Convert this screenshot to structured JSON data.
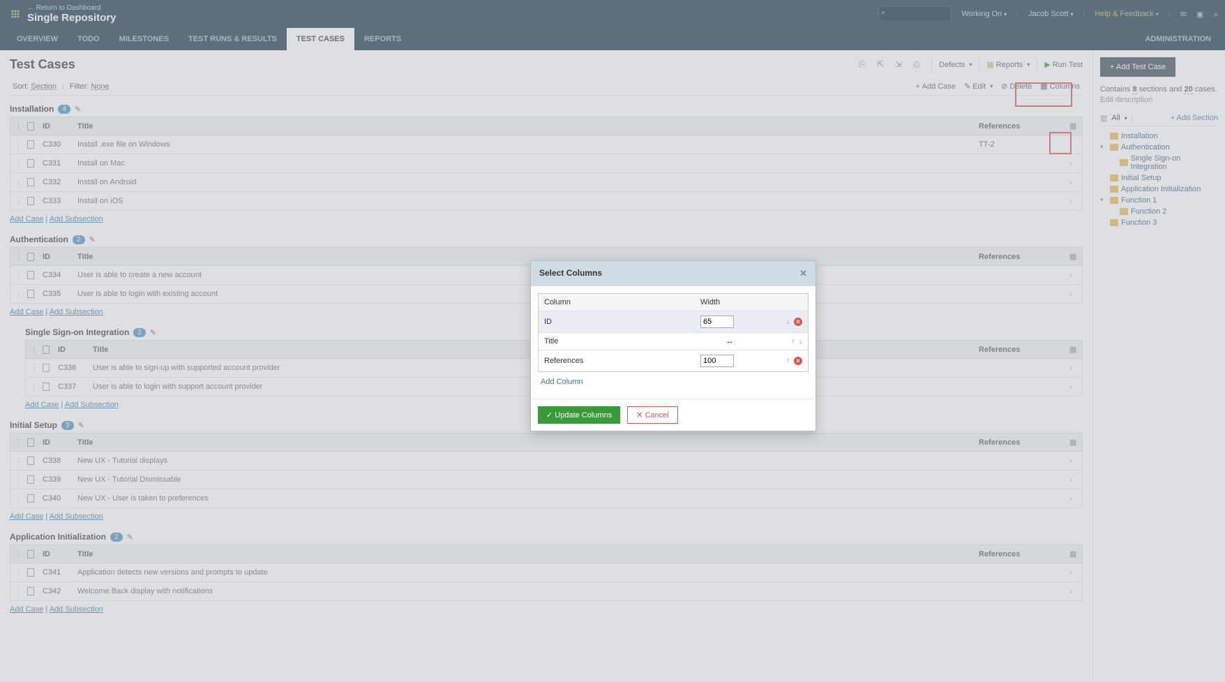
{
  "header": {
    "return_link": "← Return to Dashboard",
    "title": "Single Repository",
    "search_placeholder": "",
    "working_on": "Working On",
    "user": "Jacob Scott",
    "help": "Help & Feedback"
  },
  "nav": {
    "tabs": [
      "OVERVIEW",
      "TODO",
      "MILESTONES",
      "TEST RUNS & RESULTS",
      "TEST CASES",
      "REPORTS"
    ],
    "active_index": 4,
    "admin": "ADMINISTRATION"
  },
  "page": {
    "title": "Test Cases",
    "defects": "Defects",
    "reports": "Reports",
    "run_test": "Run Test",
    "sort_label": "Sort:",
    "sort_value": "Section",
    "filter_label": "Filter:",
    "filter_value": "None",
    "add_case": "Add Case",
    "edit": "Edit",
    "delete": "Delete",
    "columns": "Columns",
    "add_case_link": "Add Case",
    "add_subsection_link": "Add Subsection",
    "col_id": "ID",
    "col_title": "Title",
    "col_refs": "References"
  },
  "sections": [
    {
      "name": "Installation",
      "count": 4,
      "cases": [
        {
          "id": "C330",
          "title": "Install .exe file on Windows",
          "ref": "TT-2"
        },
        {
          "id": "C331",
          "title": "Install on Mac",
          "ref": ""
        },
        {
          "id": "C332",
          "title": "Install on Android",
          "ref": ""
        },
        {
          "id": "C333",
          "title": "Install on iOS",
          "ref": ""
        }
      ]
    },
    {
      "name": "Authentication",
      "count": 2,
      "cases": [
        {
          "id": "C334",
          "title": "User is able to create a new account",
          "ref": ""
        },
        {
          "id": "C335",
          "title": "User is able to login with existing account",
          "ref": ""
        }
      ],
      "subsection": {
        "name": "Single Sign-on Integration",
        "count": 2,
        "cases": [
          {
            "id": "C336",
            "title": "User is able to sign-up with supported account provider",
            "ref": ""
          },
          {
            "id": "C337",
            "title": "User is able to login with support account provider",
            "ref": ""
          }
        ]
      }
    },
    {
      "name": "Initial Setup",
      "count": 3,
      "cases": [
        {
          "id": "C338",
          "title": "New UX - Tutorial displays",
          "ref": ""
        },
        {
          "id": "C339",
          "title": "New UX - Tutorial Dismissable",
          "ref": ""
        },
        {
          "id": "C340",
          "title": "New UX - User is taken to preferences",
          "ref": ""
        }
      ]
    },
    {
      "name": "Application Initialization",
      "count": 2,
      "cases": [
        {
          "id": "C341",
          "title": "Application detects new versions and prompts to update",
          "ref": ""
        },
        {
          "id": "C342",
          "title": "Welcome Back display with notifications",
          "ref": ""
        }
      ]
    }
  ],
  "sidebar": {
    "add_test_case": "+  Add Test Case",
    "summary_pre": "Contains ",
    "sections_count": "8",
    "sections_word": " sections and ",
    "cases_count": "20",
    "cases_word": " cases.",
    "edit_description": "Edit description",
    "all": "All",
    "add_section": "+ Add Section",
    "tree": [
      {
        "label": "Installation",
        "indent": 0,
        "caret": ""
      },
      {
        "label": "Authentication",
        "indent": 0,
        "caret": "▾"
      },
      {
        "label": "Single Sign-on Integration",
        "indent": 1,
        "caret": ""
      },
      {
        "label": "Initial Setup",
        "indent": 0,
        "caret": ""
      },
      {
        "label": "Application Initialization",
        "indent": 0,
        "caret": ""
      },
      {
        "label": "Function 1",
        "indent": 0,
        "caret": "▾"
      },
      {
        "label": "Function 2",
        "indent": 1,
        "caret": ""
      },
      {
        "label": "Function 3",
        "indent": 0,
        "caret": ""
      }
    ]
  },
  "modal": {
    "title": "Select Columns",
    "col_header_column": "Column",
    "col_header_width": "Width",
    "rows": [
      {
        "name": "ID",
        "width": "65",
        "input": true,
        "up": false,
        "down": true,
        "del": true
      },
      {
        "name": "Title",
        "width": "↔",
        "input": false,
        "up": true,
        "down": true,
        "del": false
      },
      {
        "name": "References",
        "width": "100",
        "input": true,
        "up": true,
        "down": false,
        "del": true
      }
    ],
    "add_column": "Add Column",
    "update": "✓  Update Columns",
    "cancel": "✕  Cancel"
  }
}
